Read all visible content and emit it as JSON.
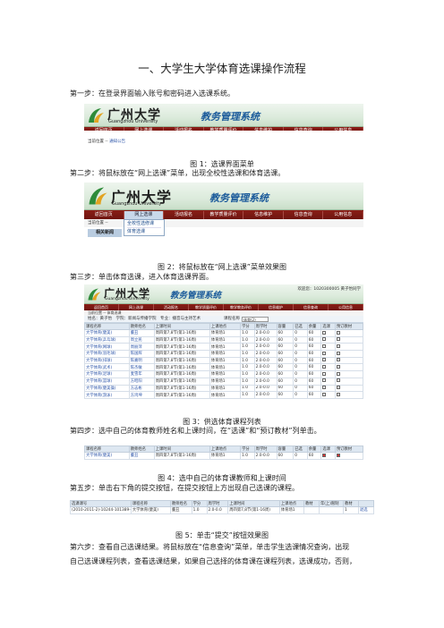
{
  "doc": {
    "title": "一、大学生大学体育选课操作流程",
    "step1": "第一步：在登录界面输入账号和密码进入选课系统。",
    "cap1": "图 1：选课界面菜单",
    "step2": "第二步：将鼠标放在“网上选课”菜单，出现全校性选课和体育选课。",
    "cap2": "图 2：将鼠标放在“网上选课”菜单效果图",
    "step3": "第三步：单击体育选课，进入体育选课界面。",
    "cap3": "图 3：供选体育课程列表",
    "step4": "第四步：选中自己的体育教师姓名和上课时间，在“选课”和“预订教材”列单击。",
    "cap4": "图 4：选中自己的体育课教师和上课时间",
    "step5": "第五步：单击右下角的提交按钮，在提交按钮上方出现自己选课的课程。",
    "cap5": "图 5：单击“提交”按钮效果图",
    "step6_l1": "第六步：查看自己选课结果。将鼠标放在“信息查询”菜单，单击学生选课情况查询，出现",
    "step6_l2": "自己选课课程列表，查看选课结果，如果自己选择的体育课在课程列表，选课成功，否则，"
  },
  "portal": {
    "school_cn": "广州大学",
    "school_en": "Guangzhou University",
    "system": "教务管理系统",
    "welcome": "欢迎您：1020300005 黄子怡同学",
    "location_prefix": "当前位置 --",
    "location1": "通知公告",
    "location3": "体育选课",
    "nav": [
      "返回首页",
      "网上选课",
      "活动报名",
      "教学质量评价",
      "信息维护",
      "信息查询",
      "公用信息"
    ],
    "nav3": [
      "返回首页",
      "网上选课",
      "活动报名",
      "教学质量评价",
      "教学教务评价",
      "信息维护",
      "信息查询",
      "公用信息"
    ],
    "dropdown": [
      "全校性选修课",
      "体育选课"
    ],
    "tab_news": "相关新闻",
    "filter": "姓名：黄子怡　学院：新闻与传播学院　专业：播音与主持艺术",
    "filter_label": "课程名称",
    "filter_select": "体育(2)"
  },
  "table3": {
    "headers": [
      "课程名称",
      "教师姓名",
      "上课时间",
      "上课地点",
      "学分",
      "周学时",
      "容量",
      "已选",
      "余量",
      "选课",
      "预订教材"
    ],
    "rows": [
      [
        "大学体育(健美)",
        "董丑",
        "周四第7,8节(第1-16周)",
        "体育场1",
        "1.0",
        "2.0-0.0",
        "60",
        "0",
        "60"
      ],
      [
        "大学体育(乒乓球)",
        "周立民",
        "周四第7,8节(第1-16周)",
        "体育场1",
        "1.0",
        "2.0-0.0",
        "60",
        "0",
        "60"
      ],
      [
        "大学体育(网球)",
        "周丽萍",
        "周四第7,8节(第1-16周)",
        "体育场1",
        "1.0",
        "2.0-0.0",
        "60",
        "0",
        "60"
      ],
      [
        "大学体育(羽毛球)",
        "陈国辉",
        "周四第7,8节(第1-16周)",
        "体育场1",
        "1.0",
        "2.0-0.0",
        "60",
        "0",
        "60"
      ],
      [
        "大学体育(排球)",
        "陈嘉明",
        "周四第7,8节(第1-16周)",
        "体育场1",
        "1.0",
        "2.0-0.0",
        "60",
        "0",
        "60"
      ],
      [
        "大学体育(武术)",
        "陈杰敏",
        "周四第7,8节(第1-16周)",
        "体育场1",
        "1.0",
        "2.0-0.0",
        "60",
        "0",
        "60"
      ],
      [
        "大学体育(足球)",
        "麦雪年",
        "周四第7,8节(第1-16周)",
        "体育场1",
        "1.0",
        "2.0-0.0",
        "60",
        "0",
        "60"
      ],
      [
        "大学体育(篮球)",
        "方昭阳",
        "周四第7,8节(第1-16周)",
        "体育场1",
        "1.0",
        "2.0-0.0",
        "60",
        "0",
        "60"
      ],
      [
        "大学体育(健美操)",
        "方志彬",
        "周四第7,8节(第1-16周)",
        "体育场1",
        "1.0",
        "2.0-0.0",
        "60",
        "0",
        "60"
      ],
      [
        "大学体育(游泳)",
        "方鸿坤",
        "周四第7,8节(第1-16周)",
        "体育场1",
        "1.0",
        "2.0-0.0",
        "60",
        "0",
        "60"
      ]
    ]
  },
  "table4": {
    "headers": [
      "课程名称",
      "教师姓名",
      "上课时间",
      "上课地点",
      "学分",
      "周学时",
      "容量",
      "已选",
      "余量",
      "选课",
      "预订教材"
    ],
    "row": [
      "大学体育(健美)",
      "董丑",
      "周四第7,8节(第1-16周)",
      "体育场1",
      "1.0",
      "2.0-0.0",
      "60",
      "0",
      "60"
    ]
  },
  "table5": {
    "headers": [
      "选课课号",
      "课程名称",
      "教师姓名",
      "学分",
      "周学时",
      "上课时间",
      "上课地点",
      "教材",
      "年(上)限制",
      "教材"
    ],
    "row": [
      "(2010-2011-2)-10244-101389-1",
      "大学体育(健美)",
      "董丑",
      "1.0",
      "2.0-0.0",
      "周四第7,8节(第1-16周)",
      "体育场1",
      "",
      "",
      "1"
    ],
    "action": "退选"
  },
  "colors": {
    "nav_bg": "#7a1a14",
    "system_text": "#1a5a9a",
    "link": "#2a53a8"
  }
}
